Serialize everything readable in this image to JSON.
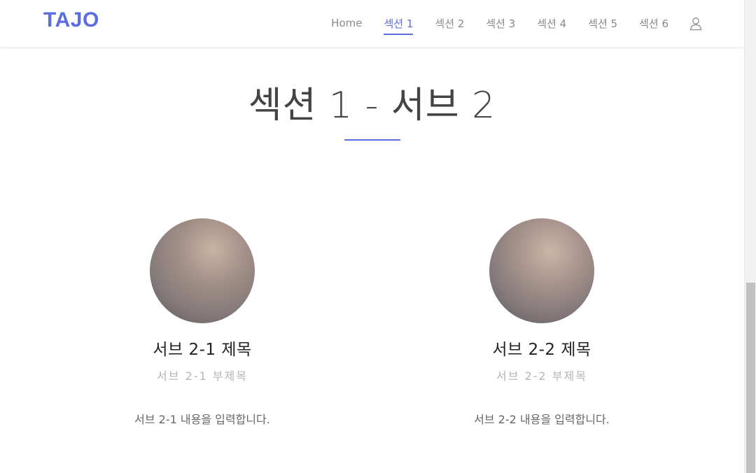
{
  "header": {
    "logo": "TAJO",
    "nav": [
      {
        "label": "Home",
        "active": false
      },
      {
        "label": "섹션 1",
        "active": true
      },
      {
        "label": "섹션 2",
        "active": false
      },
      {
        "label": "섹션 3",
        "active": false
      },
      {
        "label": "섹션 4",
        "active": false
      },
      {
        "label": "섹션 5",
        "active": false
      },
      {
        "label": "섹션 6",
        "active": false
      }
    ],
    "user_icon": "user-icon"
  },
  "section": {
    "title": "섹션 1 - 서브 2"
  },
  "cards": [
    {
      "title": "서브 2-1 제목",
      "subtitle": "서브 2-1 부제목",
      "body": "서브 2-1 내용을 입력합니다."
    },
    {
      "title": "서브 2-2 제목",
      "subtitle": "서브 2-2 부제목",
      "body": "서브 2-2 내용을 입력합니다."
    }
  ],
  "colors": {
    "accent": "#5b6ee1",
    "text_dark": "#222222",
    "text_muted": "#b5b5b5"
  }
}
